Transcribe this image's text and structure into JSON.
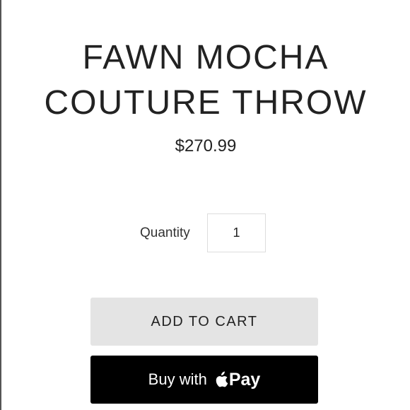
{
  "product": {
    "title_line1": "FAWN MOCHA",
    "title_line2": "COUTURE THROW",
    "price": "$270.99"
  },
  "quantity": {
    "label": "Quantity",
    "value": "1"
  },
  "actions": {
    "add_to_cart_label": "ADD TO CART",
    "buy_with_label": "Buy with",
    "pay_label": "Pay",
    "pay_icon": "apple-logo-icon"
  },
  "colors": {
    "text": "#222222",
    "add_button_bg": "#e4e4e4",
    "pay_button_bg": "#000000",
    "pay_button_text": "#ffffff"
  }
}
